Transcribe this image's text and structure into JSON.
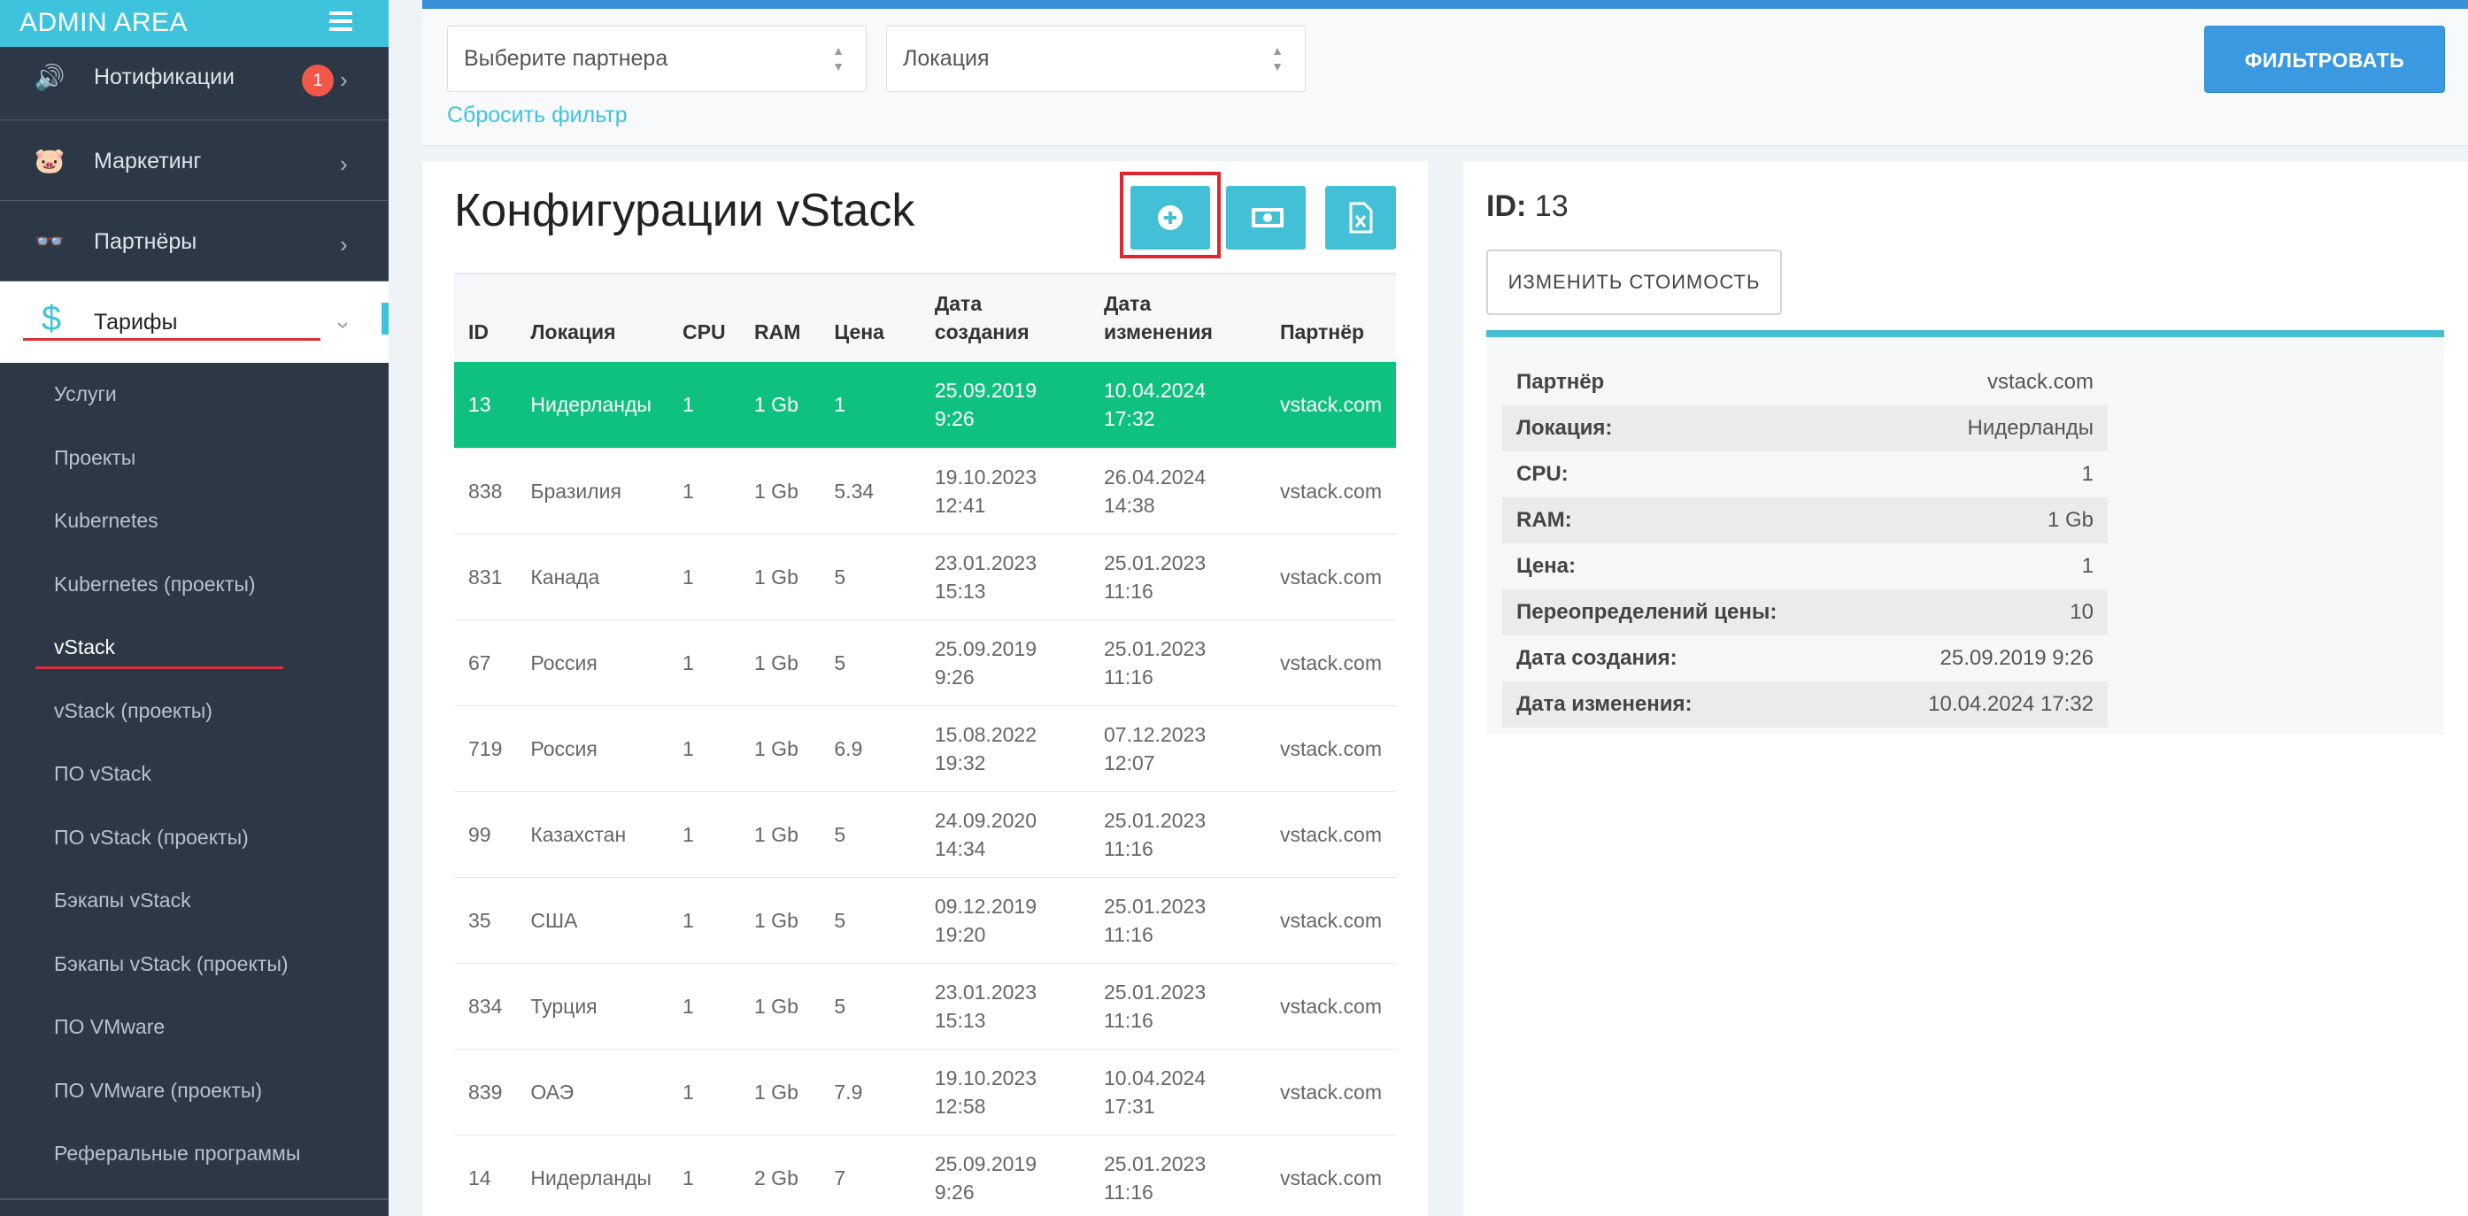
{
  "app": {
    "title": "ADMIN AREA"
  },
  "sidebar": {
    "main": [
      {
        "icon": "megaphone-icon",
        "glyph": "🔊",
        "label": "Нотификации",
        "badge": "1"
      },
      {
        "icon": "piggy-bank-icon",
        "glyph": "🐷",
        "label": "Маркетинг"
      },
      {
        "icon": "glasses-icon",
        "glyph": "👓",
        "label": "Партнёры"
      },
      {
        "icon": "dollar-icon",
        "glyph": "$",
        "label": "Тарифы",
        "active": true
      }
    ],
    "sub": [
      "Услуги",
      "Проекты",
      "Kubernetes",
      "Kubernetes (проекты)",
      "vStack",
      "vStack (проекты)",
      "ПО vStack",
      "ПО vStack (проекты)",
      "Бэкапы vStack",
      "Бэкапы vStack (проекты)",
      "ПО VMware",
      "ПО VMware (проекты)",
      "Реферальные программы"
    ],
    "active_sub": "vStack"
  },
  "filter": {
    "partner_placeholder": "Выберите партнера",
    "location_placeholder": "Локация",
    "reset_label": "Сбросить фильтр",
    "submit_label": "ФИЛЬТРОВАТЬ"
  },
  "main": {
    "title": "Конфигурации vStack",
    "columns": [
      "ID",
      "Локация",
      "CPU",
      "RAM",
      "Цена",
      "Дата создания",
      "Дата изменения",
      "Партнёр"
    ],
    "rows": [
      {
        "id": "13",
        "location": "Нидерланды",
        "cpu": "1",
        "ram": "1 Gb",
        "price": "1",
        "created": "25.09.2019 9:26",
        "updated": "10.04.2024 17:32",
        "partner": "vstack.com",
        "selected": true
      },
      {
        "id": "838",
        "location": "Бразилия",
        "cpu": "1",
        "ram": "1 Gb",
        "price": "5.34",
        "created": "19.10.2023 12:41",
        "updated": "26.04.2024 14:38",
        "partner": "vstack.com"
      },
      {
        "id": "831",
        "location": "Канада",
        "cpu": "1",
        "ram": "1 Gb",
        "price": "5",
        "created": "23.01.2023 15:13",
        "updated": "25.01.2023 11:16",
        "partner": "vstack.com"
      },
      {
        "id": "67",
        "location": "Россия",
        "cpu": "1",
        "ram": "1 Gb",
        "price": "5",
        "created": "25.09.2019 9:26",
        "updated": "25.01.2023 11:16",
        "partner": "vstack.com"
      },
      {
        "id": "719",
        "location": "Россия",
        "cpu": "1",
        "ram": "1 Gb",
        "price": "6.9",
        "created": "15.08.2022 19:32",
        "updated": "07.12.2023 12:07",
        "partner": "vstack.com"
      },
      {
        "id": "99",
        "location": "Казахстан",
        "cpu": "1",
        "ram": "1 Gb",
        "price": "5",
        "created": "24.09.2020 14:34",
        "updated": "25.01.2023 11:16",
        "partner": "vstack.com"
      },
      {
        "id": "35",
        "location": "США",
        "cpu": "1",
        "ram": "1 Gb",
        "price": "5",
        "created": "09.12.2019 19:20",
        "updated": "25.01.2023 11:16",
        "partner": "vstack.com"
      },
      {
        "id": "834",
        "location": "Турция",
        "cpu": "1",
        "ram": "1 Gb",
        "price": "5",
        "created": "23.01.2023 15:13",
        "updated": "25.01.2023 11:16",
        "partner": "vstack.com"
      },
      {
        "id": "839",
        "location": "ОАЭ",
        "cpu": "1",
        "ram": "1 Gb",
        "price": "7.9",
        "created": "19.10.2023 12:58",
        "updated": "10.04.2024 17:31",
        "partner": "vstack.com"
      },
      {
        "id": "14",
        "location": "Нидерланды",
        "cpu": "1",
        "ram": "2 Gb",
        "price": "7",
        "created": "25.09.2019 9:26",
        "updated": "25.01.2023 11:16",
        "partner": "vstack.com"
      }
    ]
  },
  "detail": {
    "id_label": "ID:",
    "id_value": "13",
    "change_price_label": "ИЗМЕНИТЬ СТОИМОСТЬ",
    "props": [
      {
        "key": "Партнёр",
        "value": "vstack.com"
      },
      {
        "key": "Локация:",
        "value": "Нидерланды"
      },
      {
        "key": "CPU:",
        "value": "1"
      },
      {
        "key": "RAM:",
        "value": "1 Gb"
      },
      {
        "key": "Цена:",
        "value": "1"
      },
      {
        "key": "Переопределений цены:",
        "value": "10"
      },
      {
        "key": "Дата создания:",
        "value": "25.09.2019 9:26"
      },
      {
        "key": "Дата изменения:",
        "value": "10.04.2024 17:32"
      }
    ]
  },
  "colors": {
    "brand": "#3ec3dd",
    "sidebar_bg": "#2d3847",
    "selected_row": "#0fc17f",
    "filter_button": "#3a99e0",
    "badge": "#f25749"
  }
}
